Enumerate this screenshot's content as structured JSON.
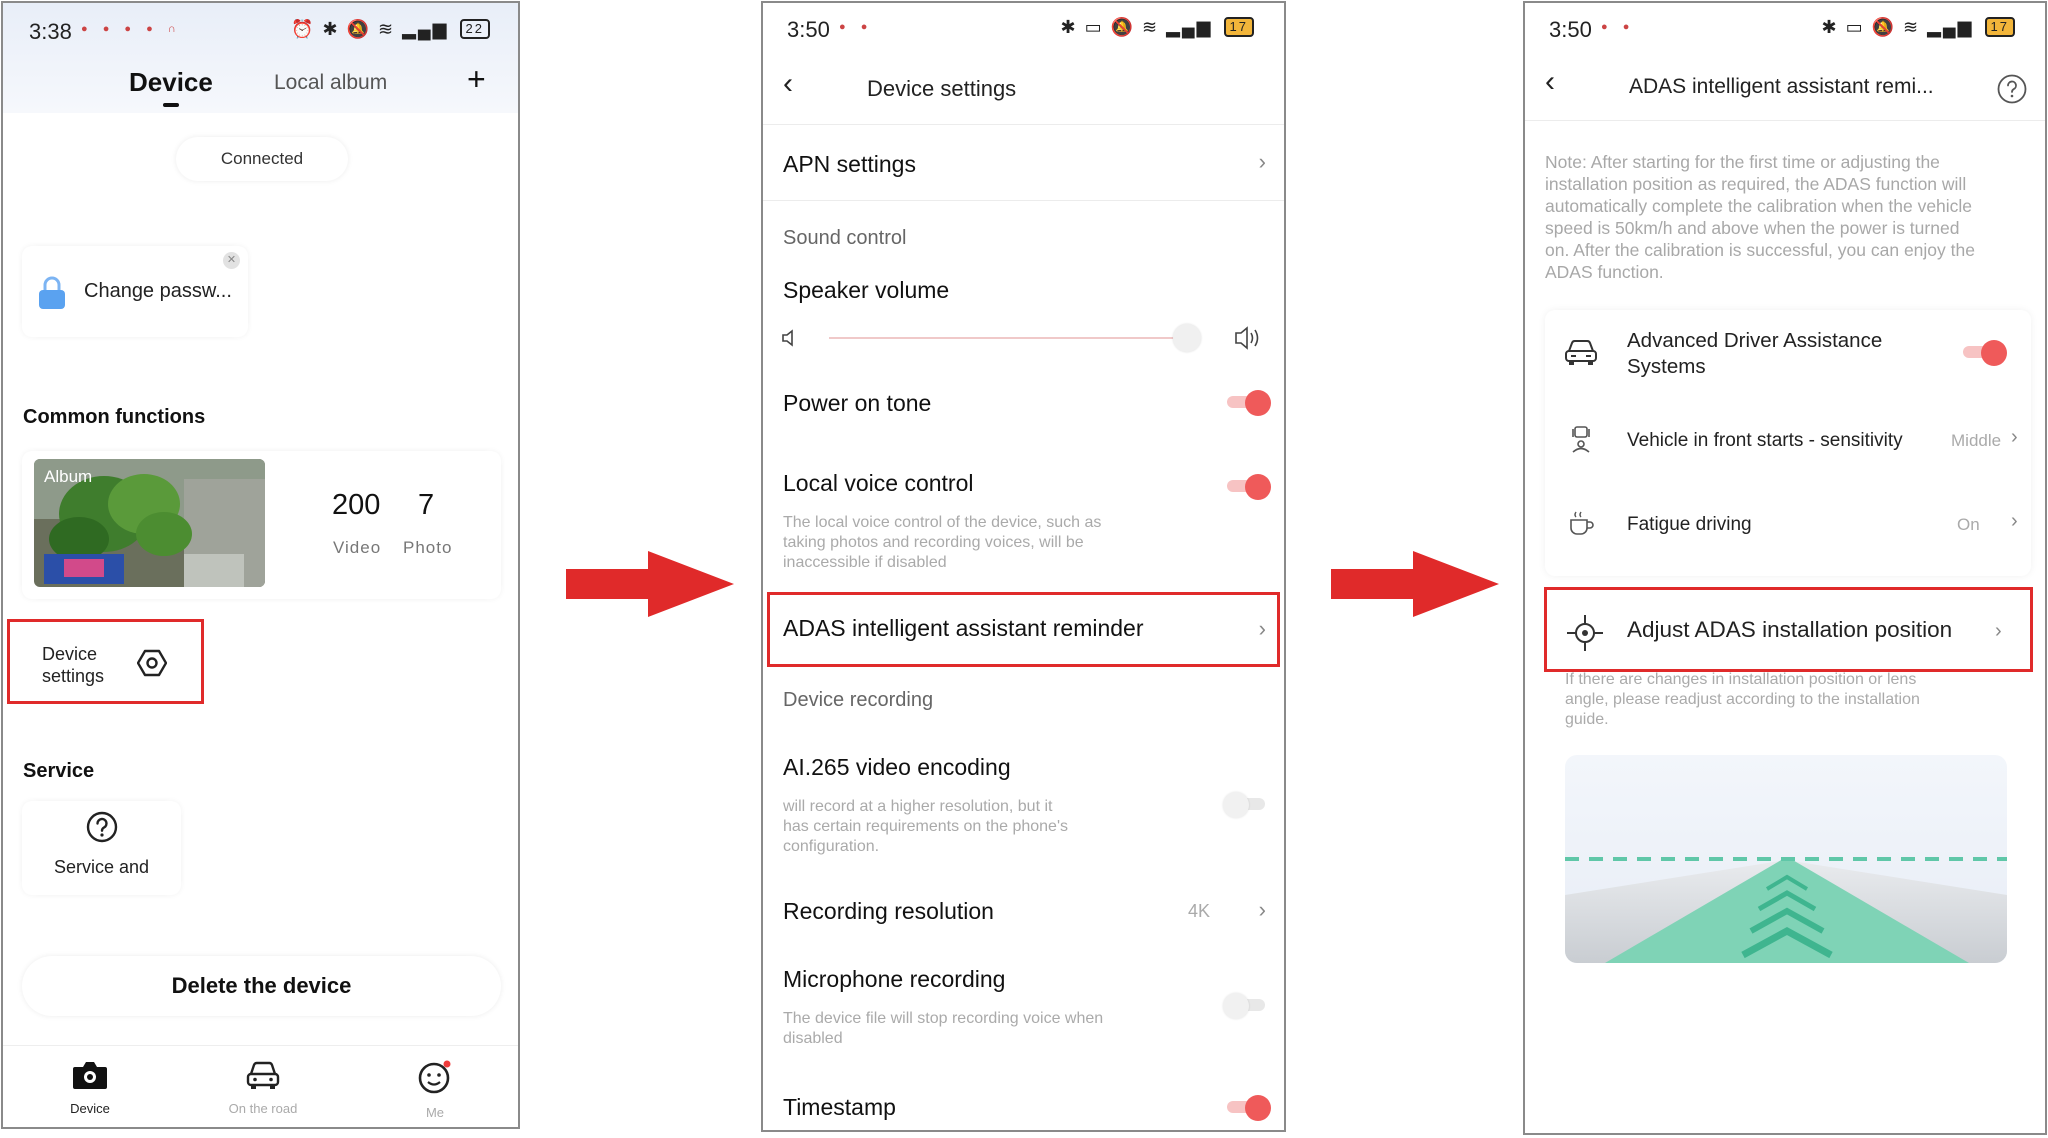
{
  "screen1": {
    "status": {
      "time": "3:38",
      "battery": "22"
    },
    "header": {
      "tab_device": "Device",
      "tab_local_album": "Local album",
      "add_symbol": "+"
    },
    "connection_status": "Connected",
    "password_card": {
      "text": "Change passw..."
    },
    "common_functions": {
      "title": "Common functions",
      "album_label": "Album",
      "video_count": "200",
      "video_label": "Video",
      "photo_count": "7",
      "photo_label": "Photo"
    },
    "device_settings": {
      "line1": "Device",
      "line2": "settings",
      "icon": "gear-hexagon-icon"
    },
    "service": {
      "title": "Service",
      "item_label": "Service and",
      "icon": "question-circle-icon"
    },
    "delete_button": "Delete the device",
    "tabbar": [
      {
        "label": "Device",
        "icon": "camera-icon",
        "active": true
      },
      {
        "label": "On the road",
        "icon": "car-icon",
        "active": false
      },
      {
        "label": "Me",
        "icon": "smiley-icon",
        "active": false
      }
    ]
  },
  "screen2": {
    "status": {
      "time": "3:50",
      "battery": "17"
    },
    "title": "Device settings",
    "apn_settings": "APN settings",
    "sound_control": "Sound control",
    "speaker_volume": "Speaker volume",
    "speaker_volume_level": 0.93,
    "power_on_tone": {
      "label": "Power on tone",
      "enabled": true
    },
    "local_voice_control": {
      "label": "Local voice control",
      "enabled": true,
      "desc_lines": [
        "The local voice control of the device, such as",
        "taking photos and recording voices, will be",
        "inaccessible if disabled"
      ]
    },
    "adas_reminder": "ADAS intelligent assistant reminder",
    "device_recording": "Device recording",
    "ai265": {
      "label": "AI.265 video encoding",
      "enabled": false,
      "desc_lines": [
        "will record at a higher resolution, but it",
        "has certain requirements on the phone's",
        "configuration."
      ]
    },
    "recording_resolution": {
      "label": "Recording resolution",
      "value": "4K"
    },
    "microphone_recording": {
      "label": "Microphone recording",
      "enabled": false,
      "desc_lines": [
        "The device file will stop recording voice when",
        "disabled"
      ]
    },
    "timestamp": {
      "label": "Timestamp",
      "enabled": true
    }
  },
  "screen3": {
    "status": {
      "time": "3:50",
      "battery": "17"
    },
    "title": "ADAS intelligent assistant remi...",
    "note_lines": [
      "Note: After starting for the first time or adjusting the",
      "installation position as required, the ADAS function will",
      "automatically complete the calibration when the vehicle",
      "speed is 50km/h and above when the power is turned",
      "on. After the calibration is successful, you can enjoy the",
      "ADAS function."
    ],
    "adas_toggle": {
      "line1": "Advanced Driver Assistance",
      "line2": "Systems",
      "enabled": true
    },
    "vehicle_front": {
      "label": "Vehicle in front starts - sensitivity",
      "value": "Middle"
    },
    "fatigue_driving": {
      "label": "Fatigue driving",
      "value": "On"
    },
    "adjust_position": {
      "label": "Adjust ADAS installation position",
      "desc_lines": [
        "If there are changes in installation position or lens",
        "angle, please readjust according to the installation",
        "guide."
      ]
    }
  },
  "colors": {
    "accent": "#ef5a5a",
    "highlight_box": "#e02a2a",
    "arrow": "#e02a2a",
    "road_green": "#7fd3b6"
  }
}
